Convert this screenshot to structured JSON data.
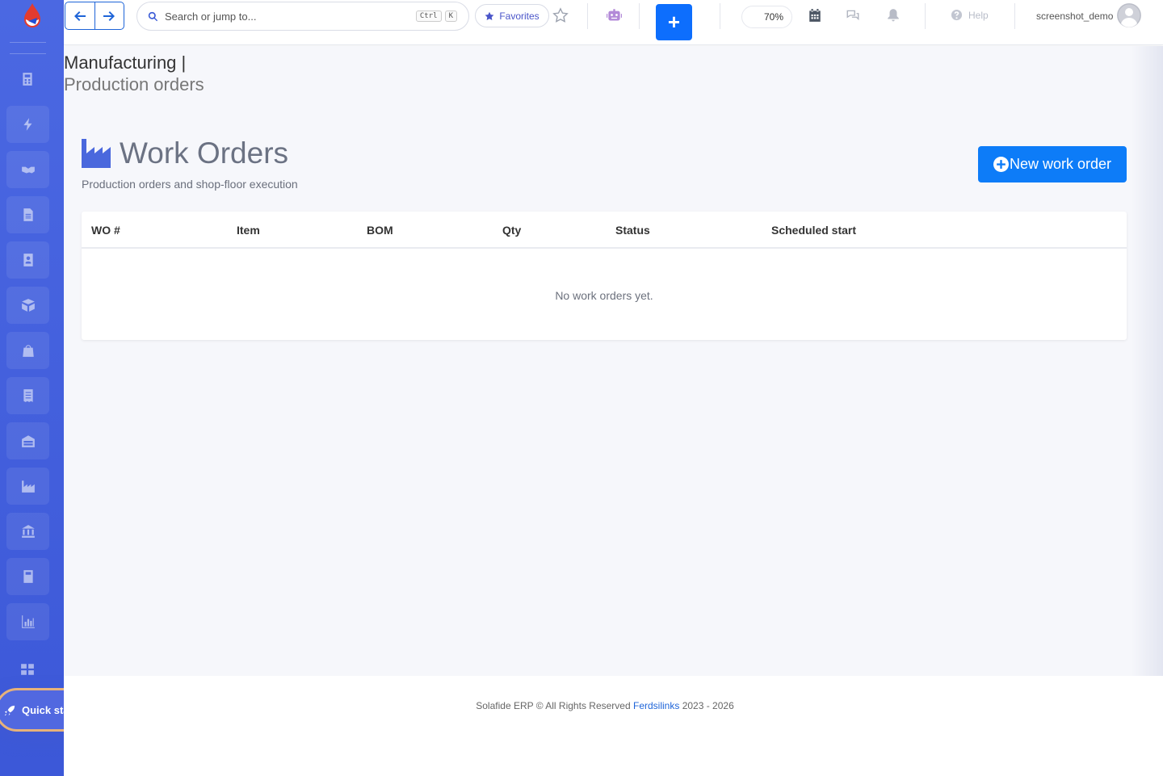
{
  "topbar": {
    "search_placeholder": "Search or jump to...",
    "kbd_ctrl": "Ctrl",
    "kbd_k": "K",
    "favorites_label": "Favorites",
    "new_label": "+",
    "zoom": "70%",
    "help_label": "Help",
    "username": "screenshot_demo"
  },
  "page": {
    "breadcrumb_module": "Manufacturing |",
    "breadcrumb_sub": "Production orders",
    "title": "Work Orders",
    "subtitle": "Production orders and shop-floor execution",
    "new_button": "New work order"
  },
  "table": {
    "columns": [
      "WO #",
      "Item",
      "BOM",
      "Qty",
      "Status",
      "Scheduled start"
    ],
    "empty_message": "No work orders yet."
  },
  "sidebar": {
    "quick_start": "Quick start",
    "icons": [
      "calculator-icon",
      "bolt-icon",
      "handshake-icon",
      "document-icon",
      "contact-icon",
      "boxes-icon",
      "bag-icon",
      "receipt-icon",
      "warehouse-icon",
      "factory-icon",
      "bank-icon",
      "book-icon",
      "chart-icon",
      "grid-icon"
    ]
  },
  "footer": {
    "text_before": "Solafide ERP © All Rights Reserved",
    "link": "Ferdsilinks",
    "text_after": "2023 - 2026"
  },
  "colors": {
    "sidebar": "#4b68e2",
    "primary": "#0d6efd",
    "accent_border": "#e7b27a"
  }
}
